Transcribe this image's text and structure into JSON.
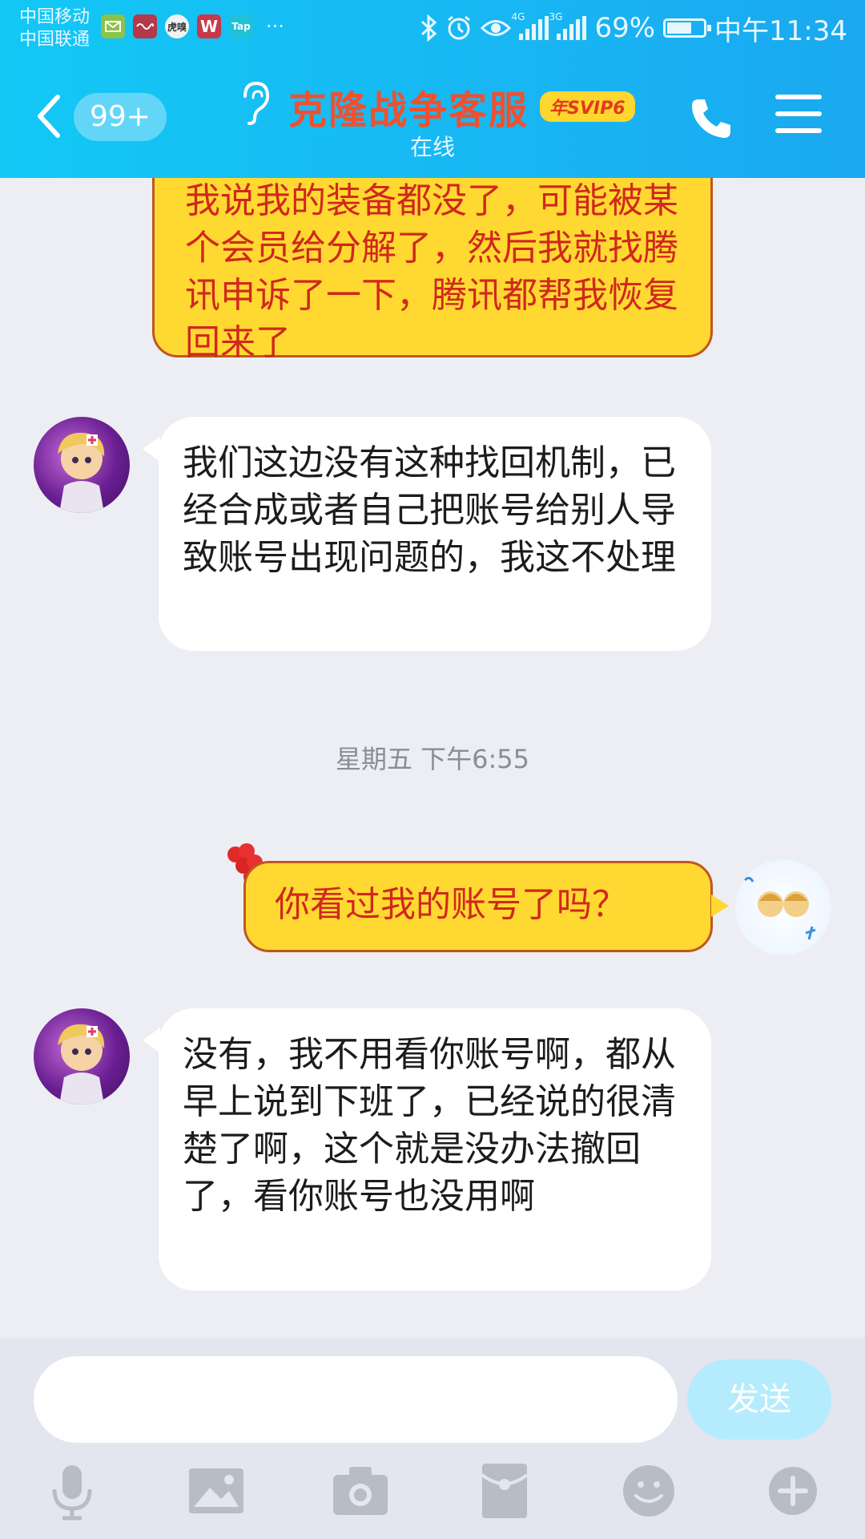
{
  "status_bar": {
    "carrier1": "中国移动",
    "carrier2": "中国联通",
    "app_icons": [
      "mail-app-icon",
      "music-app-icon",
      "huya-app-icon",
      "wps-app-icon",
      "taptap-app-icon"
    ],
    "app_icon_labels": {
      "huya": "虎嗅",
      "wps": "W",
      "tap": "Tap"
    },
    "more": "···",
    "net1": "4G",
    "net2": "3G",
    "battery_text": "69%",
    "battery_level": 0.69,
    "time": "中午11:34"
  },
  "header": {
    "back_count": "99+",
    "title": "克隆战争客服",
    "badge": "年SVIP6",
    "subtitle": "在线",
    "colors": {
      "bg": "#18b6f3",
      "title": "#f0502e"
    }
  },
  "messages": [
    {
      "side": "right",
      "style": "yellow",
      "text": "我说我的装备都没了，可能被某个会员给分解了，然后我就找腾讯申诉了一下，腾讯都帮我恢复回来了"
    },
    {
      "side": "left",
      "style": "white",
      "text": "我们这边没有这种找回机制，已经合成或者自己把账号给别人导致账号出现问题的，我这不处理"
    },
    {
      "side": "right",
      "style": "yellow",
      "text": "你看过我的账号了吗？"
    },
    {
      "side": "left",
      "style": "white",
      "text": "没有，我不用看你账号啊，都从早上说到下班了，已经说的很清楚了啊，这个就是没办法撤回了，看你账号也没用啊"
    }
  ],
  "timestamp": "星期五 下午6:55",
  "input": {
    "placeholder": "",
    "value": "",
    "send_label": "发送"
  },
  "toolbar_icons": [
    "microphone-icon",
    "image-icon",
    "camera-icon",
    "red-packet-icon",
    "emoji-icon",
    "plus-icon"
  ]
}
